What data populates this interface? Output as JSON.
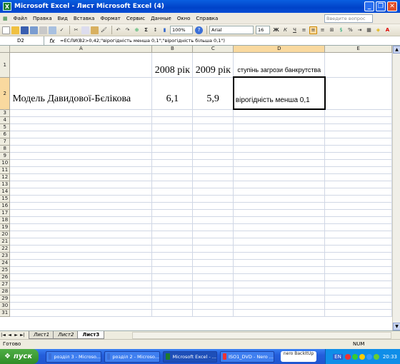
{
  "window": {
    "title": "Microsoft Excel - Лист Microsoft Excel (4)"
  },
  "menu": {
    "items": [
      "Файл",
      "Правка",
      "Вид",
      "Вставка",
      "Формат",
      "Сервис",
      "Данные",
      "Окно",
      "Справка"
    ],
    "help_placeholder": "Введите вопрос"
  },
  "toolbar": {
    "zoom": "100%",
    "font": "Arial",
    "font_size": "16"
  },
  "formula_bar": {
    "cell_ref": "D2",
    "fx": "fx",
    "formula": "=ЕСЛИ(B2>0,42;\"вірогідність менша 0,1\";\"вірогідність більша 0,1\")"
  },
  "sheet": {
    "columns": [
      "A",
      "B",
      "C",
      "D",
      "E"
    ],
    "selected_column": "D",
    "selected_row": 2,
    "row_count": 31,
    "cells": {
      "B1": "2008 рік",
      "C1": "2009 рік",
      "D1": "ступінь загрози банкрутства",
      "A2": "Модель Давидової-Бєлікова",
      "B2": "6,1",
      "C2": "5,9",
      "D2": "вірогідність менша 0,1"
    }
  },
  "sheet_tabs": [
    {
      "label": "Лист1",
      "active": false
    },
    {
      "label": "Лист2",
      "active": false
    },
    {
      "label": "Лист3",
      "active": true
    }
  ],
  "status": {
    "left": "Готово",
    "num": "NUM"
  },
  "taskbar": {
    "start": "пуск",
    "tasks": [
      {
        "label": "розділ 3 - Microso...",
        "active": false
      },
      {
        "label": "розділ 2 - Microso...",
        "active": false
      },
      {
        "label": "Microsoft Excel - ...",
        "active": true
      },
      {
        "label": "ISO1_DVD - Nero ...",
        "active": false
      }
    ],
    "nero": "nero BackItUp",
    "tray_lang": "EN",
    "clock": "20:33"
  },
  "colors": {
    "titlebar": "#0042c8",
    "taskbar": "#245edb",
    "start": "#2f8c27",
    "selection": "#000000"
  }
}
